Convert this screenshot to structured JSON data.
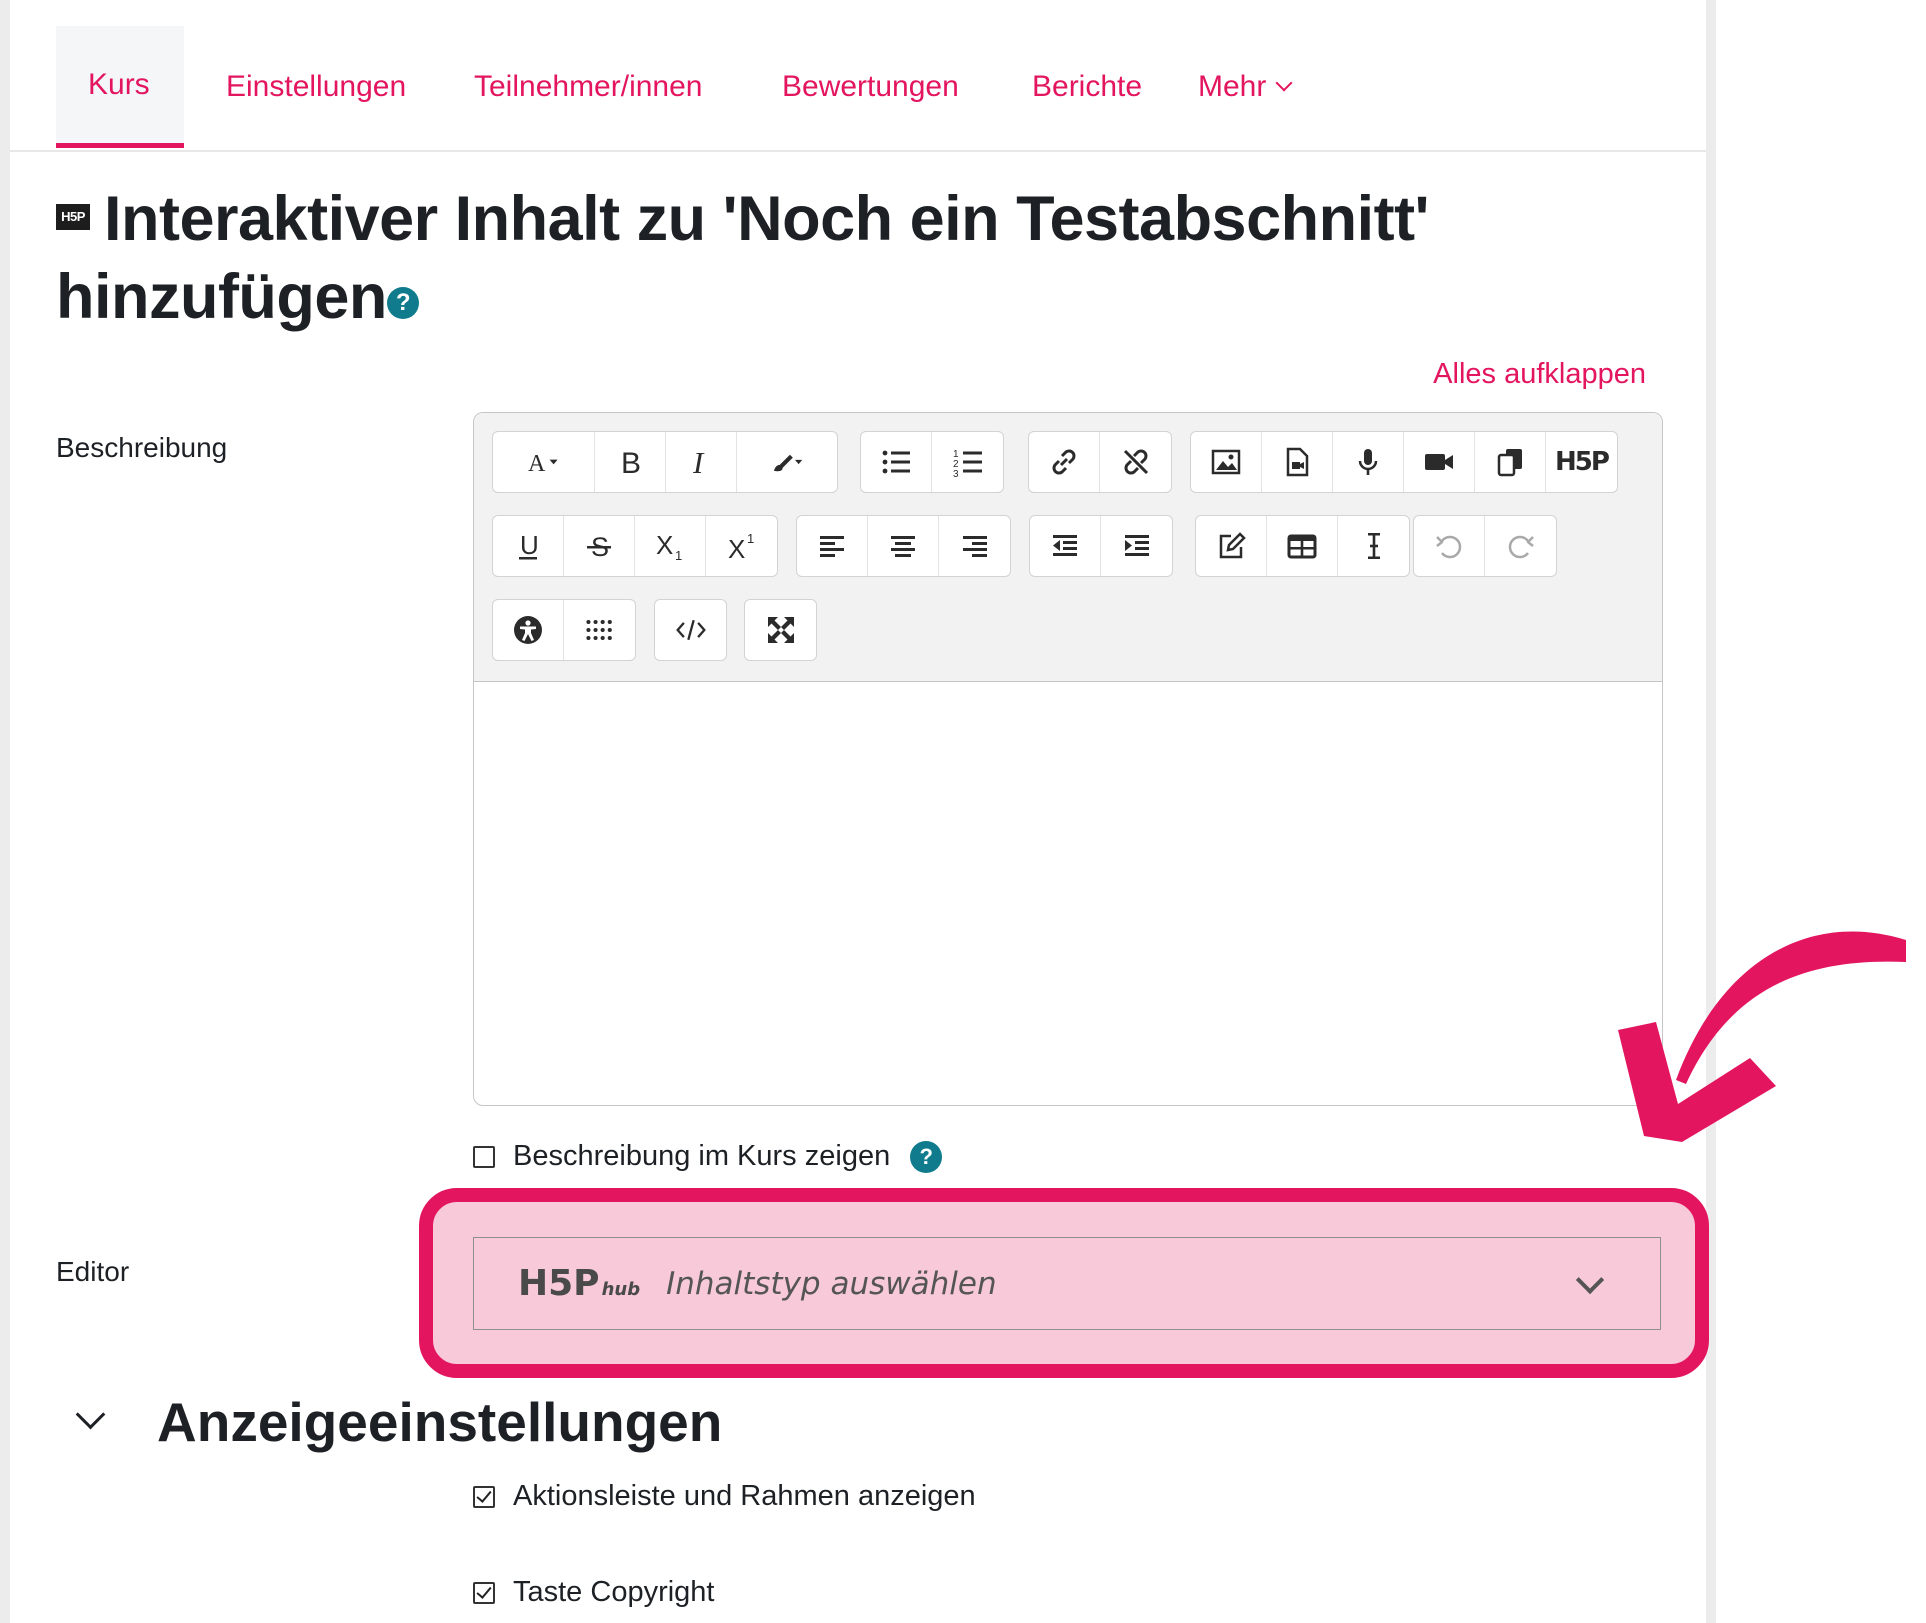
{
  "tabs": [
    {
      "label": "Kurs",
      "active": true
    },
    {
      "label": "Einstellungen"
    },
    {
      "label": "Teilnehmer/innen"
    },
    {
      "label": "Bewertungen"
    },
    {
      "label": "Berichte"
    },
    {
      "label": "Mehr"
    }
  ],
  "page": {
    "badge": "H5P",
    "title": "Interaktiver Inhalt zu 'Noch ein Testabschnitt' hinzufügen",
    "expand_all": "Alles aufklappen"
  },
  "form": {
    "description_label": "Beschreibung",
    "show_description_label": "Beschreibung im Kurs zeigen",
    "show_description_checked": false,
    "editor_label": "Editor",
    "hub_logo": "H5P",
    "hub_logo_suffix": "hub",
    "hub_placeholder": "Inhaltstyp auswählen"
  },
  "display_settings": {
    "heading": "Anzeigeeinstellungen",
    "options": [
      {
        "label": "Aktionsleiste und Rahmen anzeigen",
        "checked": true
      },
      {
        "label": "Taste Copyright",
        "checked": true
      }
    ]
  },
  "toolbar_icons": {
    "row1": [
      "font-icon",
      "bold-icon",
      "italic-icon",
      "paint-brush-icon",
      "unordered-list-icon",
      "ordered-list-icon",
      "link-icon",
      "unlink-icon",
      "image-icon",
      "media-file-icon",
      "microphone-icon",
      "video-icon",
      "copy-icon",
      "h5p-icon"
    ],
    "row2": [
      "underline-icon",
      "strikethrough-icon",
      "subscript-icon",
      "superscript-icon",
      "align-left-icon",
      "align-center-icon",
      "align-right-icon",
      "outdent-icon",
      "indent-icon",
      "edit-icon",
      "table-icon",
      "text-cursor-icon",
      "undo-icon",
      "redo-icon"
    ],
    "row3": [
      "accessibility-icon",
      "special-chars-icon",
      "code-icon",
      "fullscreen-icon"
    ],
    "h5p_button_text": "H5P"
  },
  "colors": {
    "accent": "#e3155f",
    "help": "#0f7b8c",
    "highlight_fill": "#f7c9d9"
  }
}
